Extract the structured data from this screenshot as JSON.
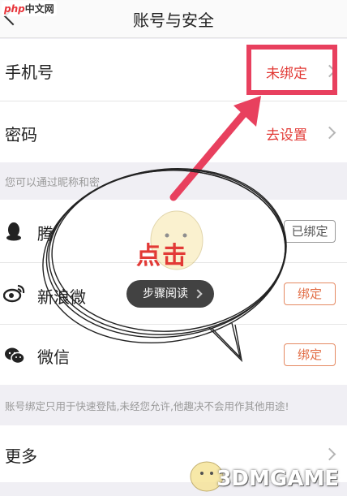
{
  "header": {
    "title": "账号与安全"
  },
  "logo": {
    "php": "php",
    "text": "中文网"
  },
  "rows": {
    "phone": {
      "label": "手机号",
      "value": "未绑定"
    },
    "password": {
      "label": "密码",
      "value": "去设置"
    }
  },
  "notes": {
    "nickname": "您可以通过昵称和密",
    "binding": "账号绑定只用于快速登陆,未经您允许,他趣决不会用作其他用途!"
  },
  "accounts": [
    {
      "name": "腾",
      "action": "已绑定",
      "icon": "qq-icon"
    },
    {
      "name": "新浪微",
      "action": "绑定",
      "icon": "weibo-icon"
    },
    {
      "name": "微信",
      "action": "绑定",
      "icon": "wechat-icon"
    }
  ],
  "more": {
    "label": "更多"
  },
  "overlay": {
    "click_label": "点击",
    "step_pill": "步骤阅读",
    "watermark": "3DMGAME"
  },
  "colors": {
    "accent": "#e23a36",
    "highlight": "#e8405e",
    "background": "#f0eff4"
  }
}
